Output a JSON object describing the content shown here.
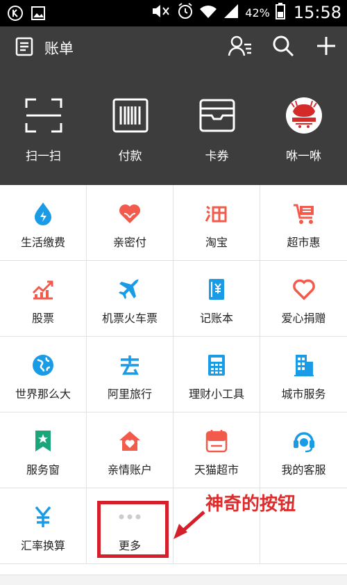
{
  "status_bar": {
    "battery": "42%",
    "time": "15:58"
  },
  "header": {
    "bill_label": "账单",
    "actions": [
      {
        "label": "扫一扫",
        "icon": "scan-icon"
      },
      {
        "label": "付款",
        "icon": "barcode-icon"
      },
      {
        "label": "卡券",
        "icon": "card-wallet-icon"
      },
      {
        "label": "咻一咻",
        "icon": "avatar-badge"
      }
    ]
  },
  "services": [
    {
      "label": "生活缴费",
      "icon": "water-drop-icon",
      "color": "#1a9be6"
    },
    {
      "label": "亲密付",
      "icon": "heart-pay-icon",
      "color": "#f25a4c"
    },
    {
      "label": "淘宝",
      "icon": "taobao-icon",
      "color": "#f25a4c"
    },
    {
      "label": "超市惠",
      "icon": "shopping-cart-icon",
      "color": "#f25a4c"
    },
    {
      "label": "股票",
      "icon": "stock-chart-icon",
      "color": "#f25a4c"
    },
    {
      "label": "机票火车票",
      "icon": "airplane-icon",
      "color": "#1a9be6"
    },
    {
      "label": "记账本",
      "icon": "ledger-icon",
      "color": "#1a9be6"
    },
    {
      "label": "爱心捐赠",
      "icon": "love-donate-icon",
      "color": "#f25a4c"
    },
    {
      "label": "世界那么大",
      "icon": "globe-icon",
      "color": "#1a9be6"
    },
    {
      "label": "阿里旅行",
      "icon": "travel-icon",
      "color": "#1a9be6"
    },
    {
      "label": "理财小工具",
      "icon": "calculator-icon",
      "color": "#1a9be6"
    },
    {
      "label": "城市服务",
      "icon": "building-icon",
      "color": "#1a9be6"
    },
    {
      "label": "服务窗",
      "icon": "star-bookmark-icon",
      "color": "#1aa57a"
    },
    {
      "label": "亲情账户",
      "icon": "family-home-icon",
      "color": "#f25a4c"
    },
    {
      "label": "天猫超市",
      "icon": "tmall-market-icon",
      "color": "#f25a4c"
    },
    {
      "label": "我的客服",
      "icon": "headset-icon",
      "color": "#1a9be6"
    },
    {
      "label": "汇率换算",
      "icon": "yen-exchange-icon",
      "color": "#1a9be6"
    },
    {
      "label": "更多",
      "icon": "more-dots-icon",
      "color": "#cccccc"
    }
  ],
  "annotation": {
    "text": "神奇的按钮",
    "color": "#e12b2b"
  }
}
